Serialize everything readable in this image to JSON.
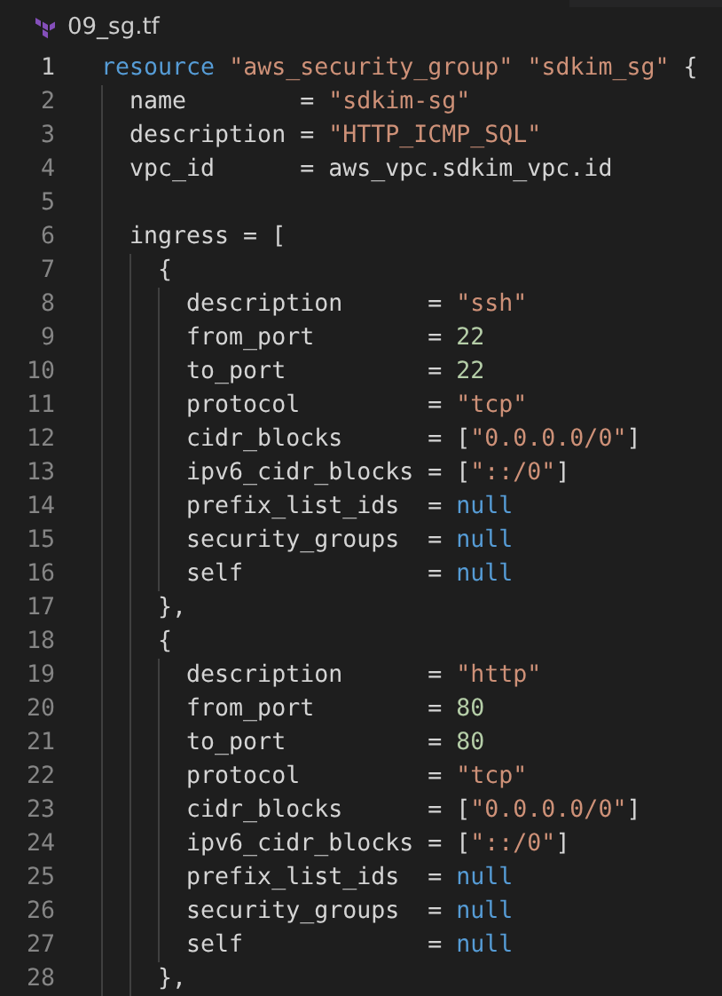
{
  "tab": {
    "title": "09_sg.tf"
  },
  "lines": [
    {
      "number": "1",
      "active": true,
      "tokens": [
        {
          "kind": "keyword",
          "text": "resource "
        },
        {
          "kind": "string",
          "text": "\"aws_security_group\" "
        },
        {
          "kind": "string",
          "text": "\"sdkim_sg\""
        },
        {
          "kind": "plain",
          "text": " {"
        }
      ]
    },
    {
      "number": "2",
      "active": false,
      "tokens": [
        {
          "kind": "plain",
          "text": "  name        = "
        },
        {
          "kind": "string",
          "text": "\"sdkim-sg\""
        }
      ]
    },
    {
      "number": "3",
      "active": false,
      "tokens": [
        {
          "kind": "plain",
          "text": "  description = "
        },
        {
          "kind": "string",
          "text": "\"HTTP_ICMP_SQL\""
        }
      ]
    },
    {
      "number": "4",
      "active": false,
      "tokens": [
        {
          "kind": "plain",
          "text": "  vpc_id      = aws_vpc.sdkim_vpc.id"
        }
      ]
    },
    {
      "number": "5",
      "active": false
    },
    {
      "number": "6",
      "active": false,
      "tokens": [
        {
          "kind": "plain",
          "text": "  ingress = ["
        }
      ]
    },
    {
      "number": "7",
      "active": false,
      "tokens": [
        {
          "kind": "plain",
          "text": "    {"
        }
      ]
    },
    {
      "number": "8",
      "active": false,
      "tokens": [
        {
          "kind": "plain",
          "text": "      description      = "
        },
        {
          "kind": "string",
          "text": "\"ssh\""
        }
      ]
    },
    {
      "number": "9",
      "active": false,
      "tokens": [
        {
          "kind": "plain",
          "text": "      from_port        = "
        },
        {
          "kind": "number",
          "text": "22"
        }
      ]
    },
    {
      "number": "10",
      "active": false,
      "tokens": [
        {
          "kind": "plain",
          "text": "      to_port          = "
        },
        {
          "kind": "number",
          "text": "22"
        }
      ]
    },
    {
      "number": "11",
      "active": false,
      "tokens": [
        {
          "kind": "plain",
          "text": "      protocol         = "
        },
        {
          "kind": "string",
          "text": "\"tcp\""
        }
      ]
    },
    {
      "number": "12",
      "active": false,
      "tokens": [
        {
          "kind": "plain",
          "text": "      cidr_blocks      = ["
        },
        {
          "kind": "string",
          "text": "\"0.0.0.0/0\""
        },
        {
          "kind": "plain",
          "text": "]"
        }
      ]
    },
    {
      "number": "13",
      "active": false,
      "tokens": [
        {
          "kind": "plain",
          "text": "      ipv6_cidr_blocks = ["
        },
        {
          "kind": "string",
          "text": "\"::/0\""
        },
        {
          "kind": "plain",
          "text": "]"
        }
      ]
    },
    {
      "number": "14",
      "active": false,
      "tokens": [
        {
          "kind": "plain",
          "text": "      prefix_list_ids  = "
        },
        {
          "kind": "null",
          "text": "null"
        }
      ]
    },
    {
      "number": "15",
      "active": false,
      "tokens": [
        {
          "kind": "plain",
          "text": "      security_groups  = "
        },
        {
          "kind": "null",
          "text": "null"
        }
      ]
    },
    {
      "number": "16",
      "active": false,
      "tokens": [
        {
          "kind": "plain",
          "text": "      self             = "
        },
        {
          "kind": "null",
          "text": "null"
        }
      ]
    },
    {
      "number": "17",
      "active": false,
      "tokens": [
        {
          "kind": "plain",
          "text": "    },"
        }
      ]
    },
    {
      "number": "18",
      "active": false,
      "tokens": [
        {
          "kind": "plain",
          "text": "    {"
        }
      ]
    },
    {
      "number": "19",
      "active": false,
      "tokens": [
        {
          "kind": "plain",
          "text": "      description      = "
        },
        {
          "kind": "string",
          "text": "\"http\""
        }
      ]
    },
    {
      "number": "20",
      "active": false,
      "tokens": [
        {
          "kind": "plain",
          "text": "      from_port        = "
        },
        {
          "kind": "number",
          "text": "80"
        }
      ]
    },
    {
      "number": "21",
      "active": false,
      "tokens": [
        {
          "kind": "plain",
          "text": "      to_port          = "
        },
        {
          "kind": "number",
          "text": "80"
        }
      ]
    },
    {
      "number": "22",
      "active": false,
      "tokens": [
        {
          "kind": "plain",
          "text": "      protocol         = "
        },
        {
          "kind": "string",
          "text": "\"tcp\""
        }
      ]
    },
    {
      "number": "23",
      "active": false,
      "tokens": [
        {
          "kind": "plain",
          "text": "      cidr_blocks      = ["
        },
        {
          "kind": "string",
          "text": "\"0.0.0.0/0\""
        },
        {
          "kind": "plain",
          "text": "]"
        }
      ]
    },
    {
      "number": "24",
      "active": false,
      "tokens": [
        {
          "kind": "plain",
          "text": "      ipv6_cidr_blocks = ["
        },
        {
          "kind": "string",
          "text": "\"::/0\""
        },
        {
          "kind": "plain",
          "text": "]"
        }
      ]
    },
    {
      "number": "25",
      "active": false,
      "tokens": [
        {
          "kind": "plain",
          "text": "      prefix_list_ids  = "
        },
        {
          "kind": "null",
          "text": "null"
        }
      ]
    },
    {
      "number": "26",
      "active": false,
      "tokens": [
        {
          "kind": "plain",
          "text": "      security_groups  = "
        },
        {
          "kind": "null",
          "text": "null"
        }
      ]
    },
    {
      "number": "27",
      "active": false,
      "tokens": [
        {
          "kind": "plain",
          "text": "      self             = "
        },
        {
          "kind": "null",
          "text": "null"
        }
      ]
    },
    {
      "number": "28",
      "active": false,
      "tokens": [
        {
          "kind": "plain",
          "text": "    },"
        }
      ]
    }
  ]
}
